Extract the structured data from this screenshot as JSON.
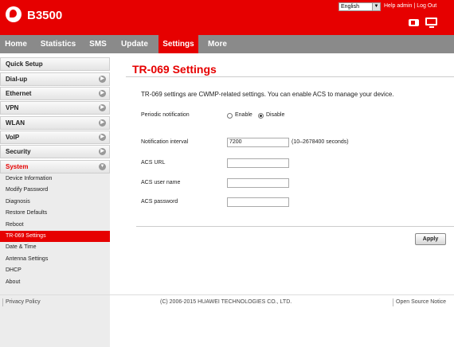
{
  "header": {
    "brand": "B3500",
    "language": "English",
    "help_label": "Help",
    "user_label": "admin",
    "logout_label": "Log Out"
  },
  "nav": {
    "items": [
      {
        "label": "Home"
      },
      {
        "label": "Statistics"
      },
      {
        "label": "SMS"
      },
      {
        "label": "Update"
      },
      {
        "label": "Settings",
        "active": true
      },
      {
        "label": "More"
      }
    ]
  },
  "sidebar": {
    "quick_setup": "Quick Setup",
    "sections": [
      {
        "label": "Dial-up"
      },
      {
        "label": "Ethernet"
      },
      {
        "label": "VPN"
      },
      {
        "label": "WLAN"
      },
      {
        "label": "VoIP"
      },
      {
        "label": "Security"
      },
      {
        "label": "System",
        "expanded": true
      }
    ],
    "system_items": [
      {
        "label": "Device Information"
      },
      {
        "label": "Modify Password"
      },
      {
        "label": "Diagnosis"
      },
      {
        "label": "Restore Defaults"
      },
      {
        "label": "Reboot"
      },
      {
        "label": "TR-069 Settings",
        "active": true
      },
      {
        "label": "Date & Time"
      },
      {
        "label": "Antenna Settings"
      },
      {
        "label": "DHCP"
      },
      {
        "label": "About"
      }
    ]
  },
  "main": {
    "title": "TR-069 Settings",
    "description": "TR-069 settings are CWMP-related settings. You can enable ACS to manage your device.",
    "periodic_notification_label": "Periodic notification",
    "enable_label": "Enable",
    "disable_label": "Disable",
    "selected": "Disable",
    "notification_interval_label": "Notification interval",
    "notification_interval_value": "7200",
    "notification_interval_hint": "(10–2678400 seconds)",
    "acs_url_label": "ACS URL",
    "acs_url_value": "",
    "acs_user_label": "ACS user name",
    "acs_user_value": "",
    "acs_password_label": "ACS password",
    "acs_password_value": "",
    "apply_label": "Apply"
  },
  "footer": {
    "privacy": "Privacy Policy",
    "copyright": "(C) 2006-2015 HUAWEI TECHNOLOGIES CO., LTD.",
    "open_source": "Open Source Notice"
  },
  "colors": {
    "brand_red": "#e60000",
    "nav_gray": "#8a8a8a"
  }
}
